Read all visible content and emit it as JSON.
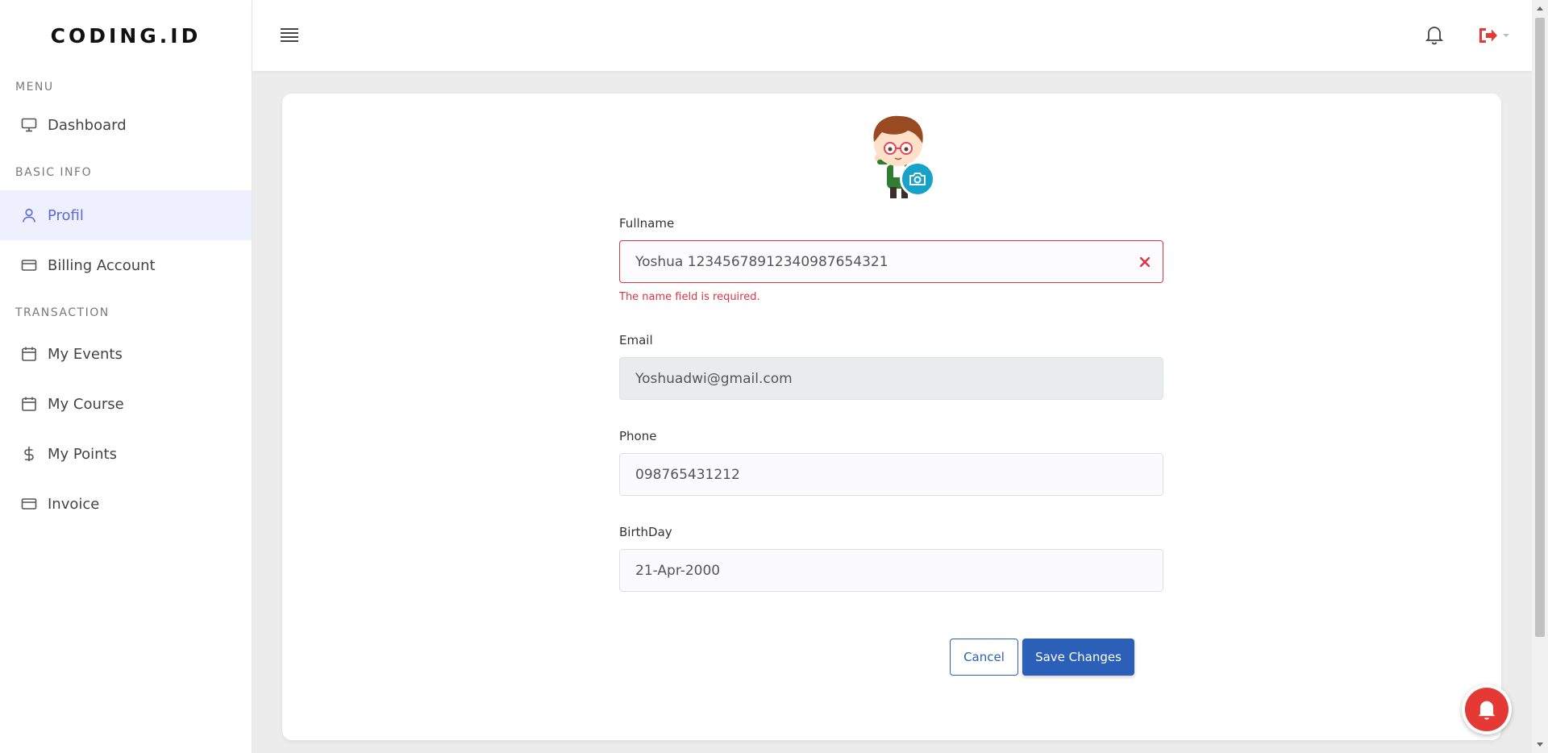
{
  "brand": {
    "logo_text": "CODING.ID"
  },
  "sidebar": {
    "sections": [
      {
        "title": "MENU",
        "items": [
          {
            "label": "Dashboard",
            "icon": "monitor-icon"
          }
        ]
      },
      {
        "title": "BASIC INFO",
        "items": [
          {
            "label": "Profil",
            "icon": "user-icon",
            "active": true
          },
          {
            "label": "Billing Account",
            "icon": "credit-card-icon"
          }
        ]
      },
      {
        "title": "TRANSACTION",
        "items": [
          {
            "label": "My Events",
            "icon": "calendar-icon"
          },
          {
            "label": "My Course",
            "icon": "calendar-icon"
          },
          {
            "label": "My Points",
            "icon": "dollar-icon"
          },
          {
            "label": "Invoice",
            "icon": "credit-card-icon"
          }
        ]
      }
    ]
  },
  "header": {
    "menu_toggle_icon": "hamburger-icon",
    "notification_icon": "bell-icon",
    "logout_icon": "logout-icon"
  },
  "form": {
    "fullname": {
      "label": "Fullname",
      "value": "Yoshua 12345678912340987654321",
      "error": "The name field is required."
    },
    "email": {
      "label": "Email",
      "value": "Yoshuadwi@gmail.com",
      "disabled": true
    },
    "phone": {
      "label": "Phone",
      "value": "098765431212"
    },
    "birthday": {
      "label": "BirthDay",
      "value": "21-Apr-2000"
    },
    "cancel_label": "Cancel",
    "save_label": "Save Changes"
  },
  "colors": {
    "primary": "#2c5fb8",
    "error": "#dc3545",
    "active_nav": "#5b6bd8",
    "camera_badge": "#17a2c8",
    "notification_fab": "#e53935"
  }
}
